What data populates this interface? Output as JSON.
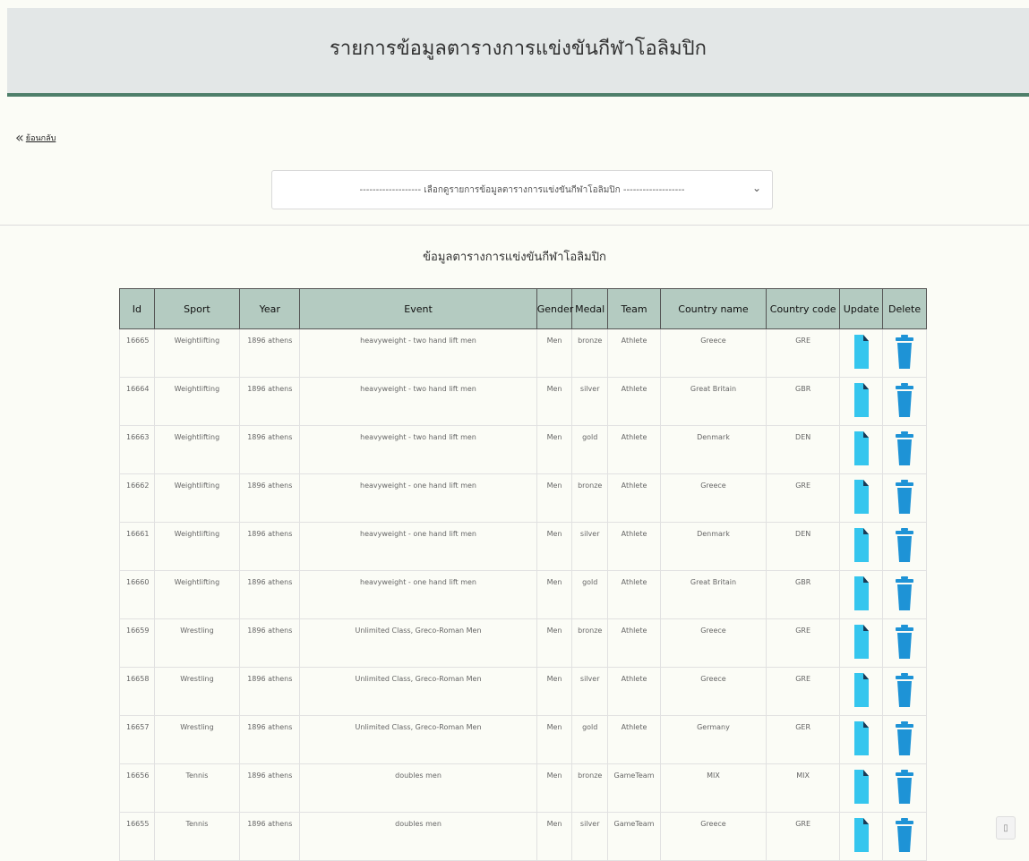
{
  "header": {
    "title": "รายการข้อมูลตารางการแข่งขันกีฬาโอลิมปิก"
  },
  "back": {
    "label": "ย้อนกลับ"
  },
  "filter": {
    "selected": "------------------- เลือกดูรายการข้อมูลตารางการแข่งขันกีฬาโอลิมปิก -------------------"
  },
  "section": {
    "title": "ข้อมูลตารางการแข่งขันกีฬาโอลิมปิก"
  },
  "table": {
    "columns": [
      "Id",
      "Sport",
      "Year",
      "Event",
      "Gender",
      "Medal",
      "Team",
      "Country name",
      "Country code",
      "Update",
      "Delete"
    ],
    "rows": [
      [
        "16665",
        "Weightlifting",
        "1896 athens",
        "heavyweight - two hand lift men",
        "Men",
        "bronze",
        "Athlete",
        "Greece",
        "GRE"
      ],
      [
        "16664",
        "Weightlifting",
        "1896 athens",
        "heavyweight - two hand lift men",
        "Men",
        "silver",
        "Athlete",
        "Great Britain",
        "GBR"
      ],
      [
        "16663",
        "Weightlifting",
        "1896 athens",
        "heavyweight - two hand lift men",
        "Men",
        "gold",
        "Athlete",
        "Denmark",
        "DEN"
      ],
      [
        "16662",
        "Weightlifting",
        "1896 athens",
        "heavyweight - one hand lift men",
        "Men",
        "bronze",
        "Athlete",
        "Greece",
        "GRE"
      ],
      [
        "16661",
        "Weightlifting",
        "1896 athens",
        "heavyweight - one hand lift men",
        "Men",
        "silver",
        "Athlete",
        "Denmark",
        "DEN"
      ],
      [
        "16660",
        "Weightlifting",
        "1896 athens",
        "heavyweight - one hand lift men",
        "Men",
        "gold",
        "Athlete",
        "Great Britain",
        "GBR"
      ],
      [
        "16659",
        "Wrestling",
        "1896 athens",
        "Unlimited Class, Greco-Roman Men",
        "Men",
        "bronze",
        "Athlete",
        "Greece",
        "GRE"
      ],
      [
        "16658",
        "Wrestling",
        "1896 athens",
        "Unlimited Class, Greco-Roman Men",
        "Men",
        "silver",
        "Athlete",
        "Greece",
        "GRE"
      ],
      [
        "16657",
        "Wrestling",
        "1896 athens",
        "Unlimited Class, Greco-Roman Men",
        "Men",
        "gold",
        "Athlete",
        "Germany",
        "GER"
      ],
      [
        "16656",
        "Tennis",
        "1896 athens",
        "doubles men",
        "Men",
        "bronze",
        "GameTeam",
        "MIX",
        "MIX"
      ],
      [
        "16655",
        "Tennis",
        "1896 athens",
        "doubles men",
        "Men",
        "silver",
        "GameTeam",
        "Greece",
        "GRE"
      ]
    ]
  },
  "icons": {
    "update": "document-icon",
    "delete": "trash-icon",
    "back": "chevron-left-icon",
    "dropdown": "chevron-down-icon"
  },
  "colors": {
    "header_bg": "#e3e7e7",
    "header_border": "#4e7f6a",
    "table_header_bg": "#b4cbc1",
    "update_icon": "#35c6ee",
    "delete_icon": "#1e93d6"
  }
}
